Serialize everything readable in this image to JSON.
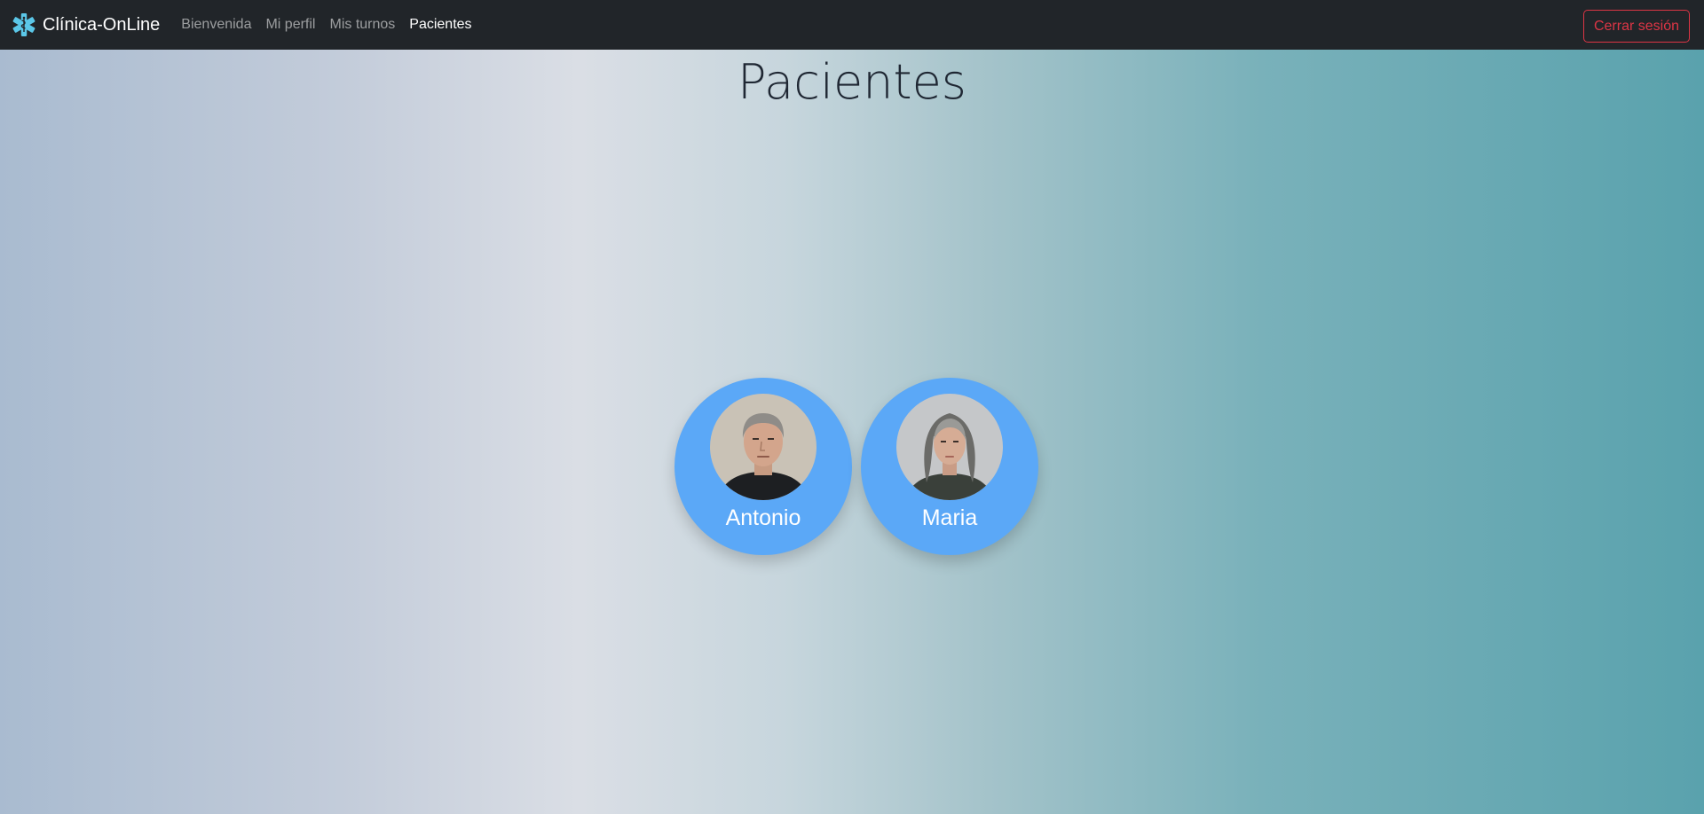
{
  "navbar": {
    "brand": "Clínica-OnLine",
    "brand_icon": "medical-star-icon",
    "brand_color": "#5bc7e8",
    "links": [
      {
        "label": "Bienvenida",
        "active": false
      },
      {
        "label": "Mi perfil",
        "active": false
      },
      {
        "label": "Mis turnos",
        "active": false
      },
      {
        "label": "Pacientes",
        "active": true
      }
    ],
    "logout_label": "Cerrar sesión"
  },
  "main": {
    "title": "Pacientes",
    "patients": [
      {
        "name": "Antonio",
        "avatar": "man-portrait"
      },
      {
        "name": "Maria",
        "avatar": "woman-portrait"
      }
    ]
  },
  "colors": {
    "navbar_bg": "#212529",
    "card_bg": "#5ba8f7",
    "logout": "#dc3545"
  }
}
